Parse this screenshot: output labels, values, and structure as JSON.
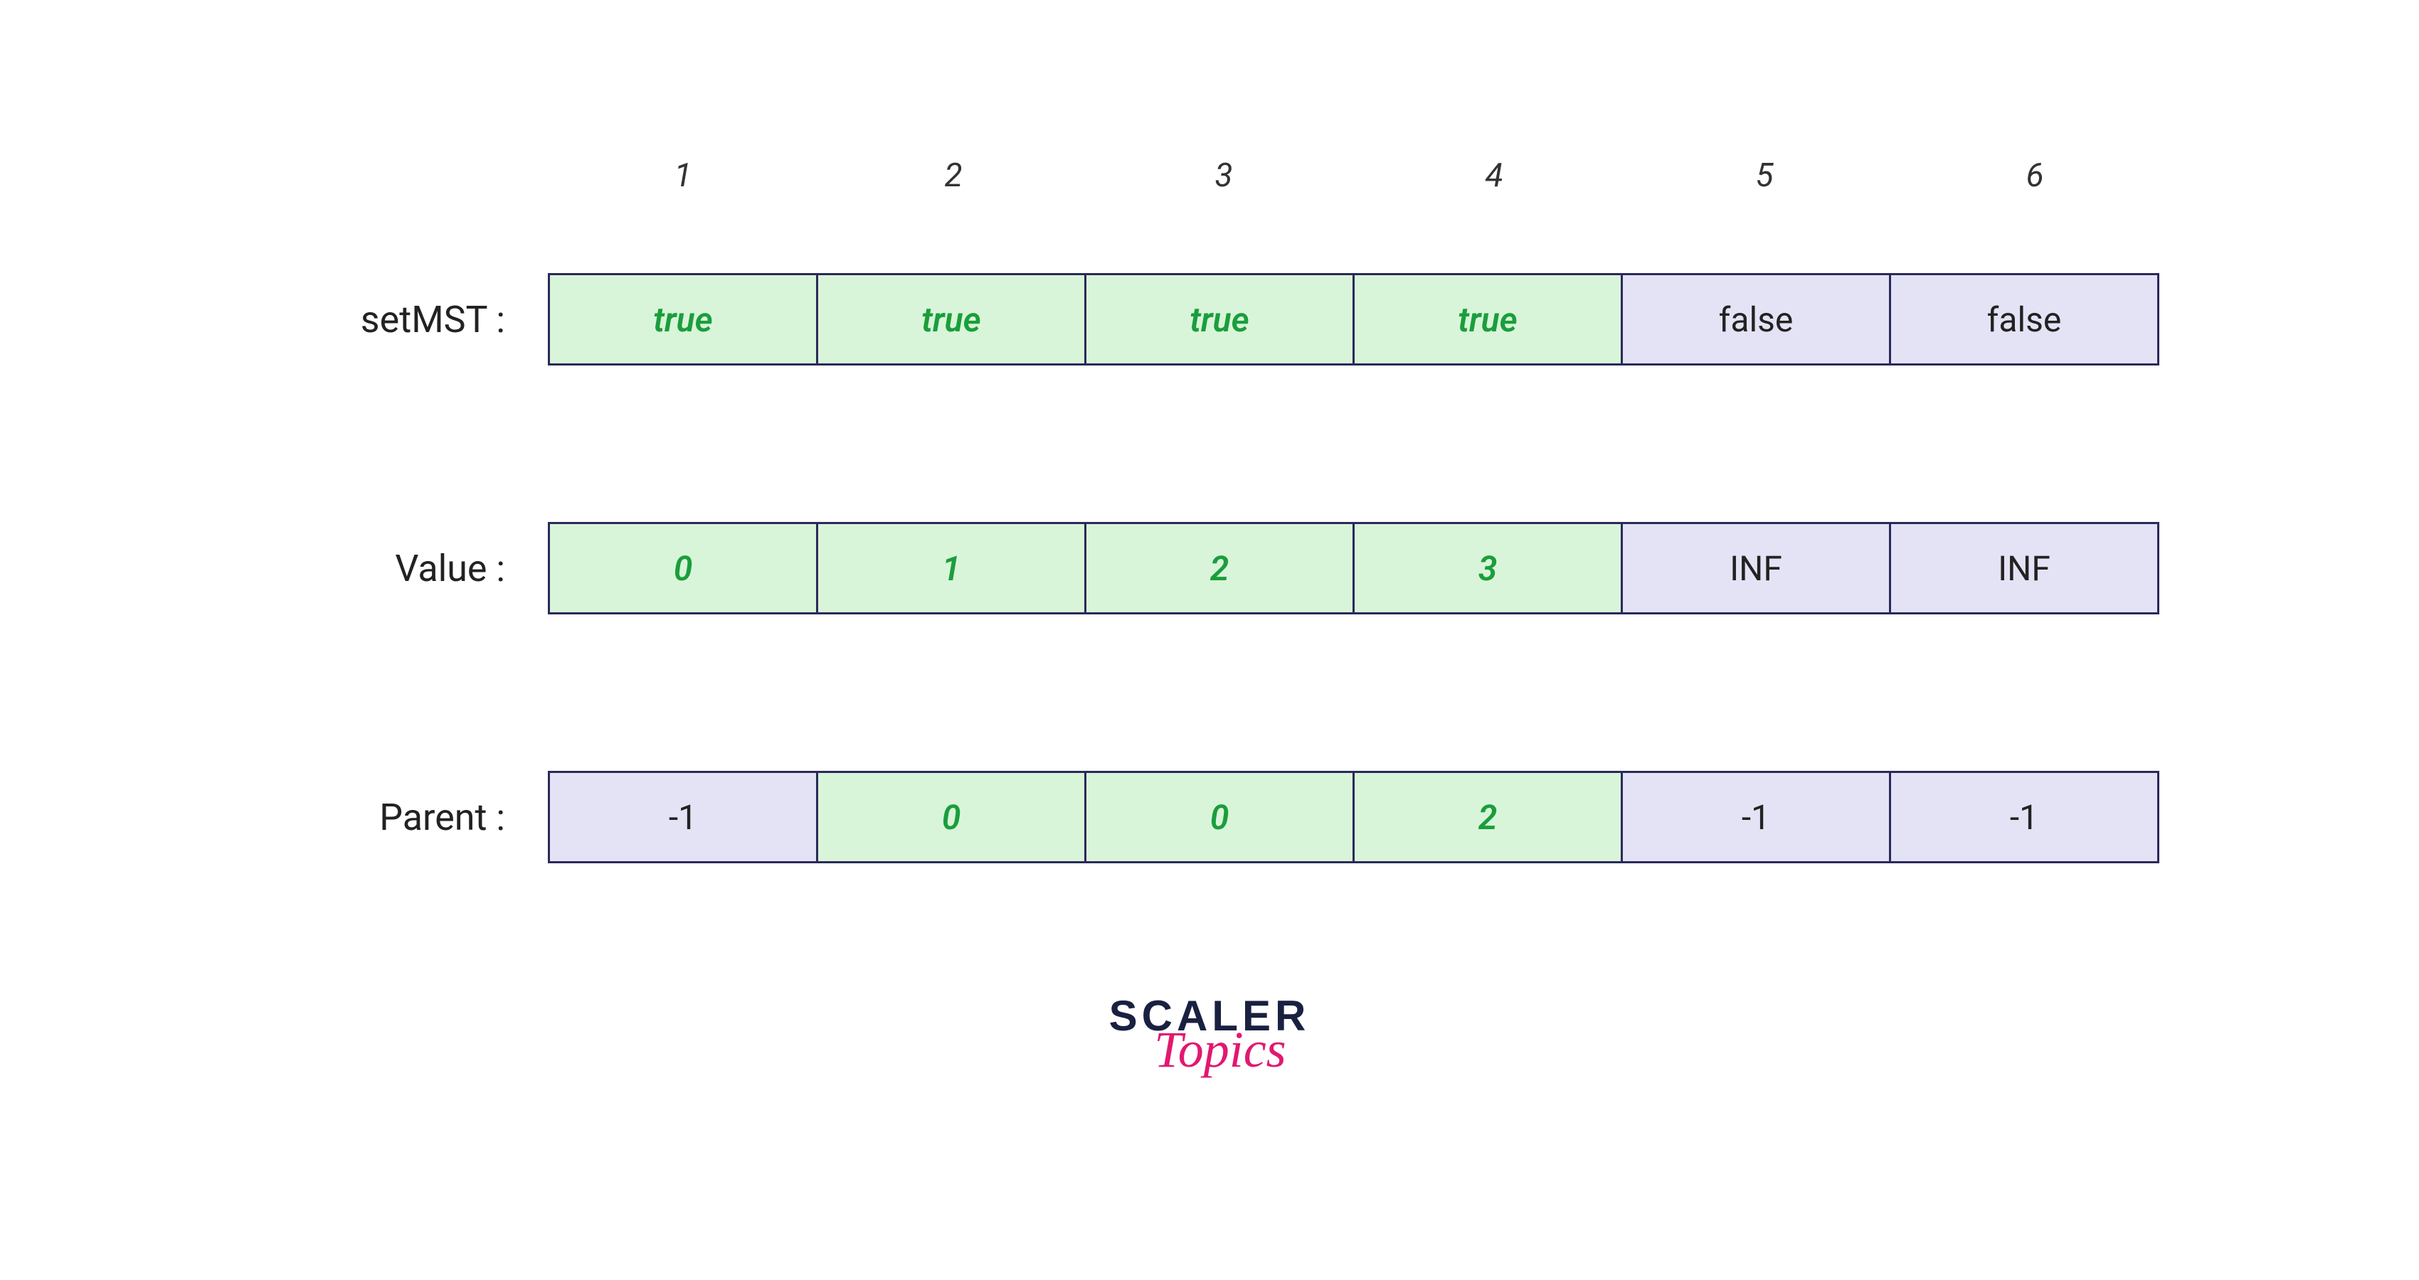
{
  "indices": [
    "1",
    "2",
    "3",
    "4",
    "5",
    "6"
  ],
  "rows": [
    {
      "label": "setMST :",
      "cells": [
        {
          "value": "true",
          "style": "green"
        },
        {
          "value": "true",
          "style": "green"
        },
        {
          "value": "true",
          "style": "green"
        },
        {
          "value": "true",
          "style": "green"
        },
        {
          "value": "false",
          "style": "purple"
        },
        {
          "value": "false",
          "style": "purple"
        }
      ]
    },
    {
      "label": "Value :",
      "cells": [
        {
          "value": "0",
          "style": "green"
        },
        {
          "value": "1",
          "style": "green"
        },
        {
          "value": "2",
          "style": "green"
        },
        {
          "value": "3",
          "style": "green"
        },
        {
          "value": "INF",
          "style": "purple"
        },
        {
          "value": "INF",
          "style": "purple"
        }
      ]
    },
    {
      "label": "Parent :",
      "cells": [
        {
          "value": "-1",
          "style": "purple"
        },
        {
          "value": "0",
          "style": "green"
        },
        {
          "value": "0",
          "style": "green"
        },
        {
          "value": "2",
          "style": "green"
        },
        {
          "value": "-1",
          "style": "purple"
        },
        {
          "value": "-1",
          "style": "purple"
        }
      ]
    }
  ],
  "logo": {
    "line1": "SCALER",
    "line2": "Topics"
  },
  "chart_data": {
    "type": "table",
    "description": "Prim's MST algorithm state arrays",
    "columns": [
      1,
      2,
      3,
      4,
      5,
      6
    ],
    "setMST": [
      true,
      true,
      true,
      true,
      false,
      false
    ],
    "Value": [
      0,
      1,
      2,
      3,
      "INF",
      "INF"
    ],
    "Parent": [
      -1,
      0,
      0,
      2,
      -1,
      -1
    ]
  }
}
